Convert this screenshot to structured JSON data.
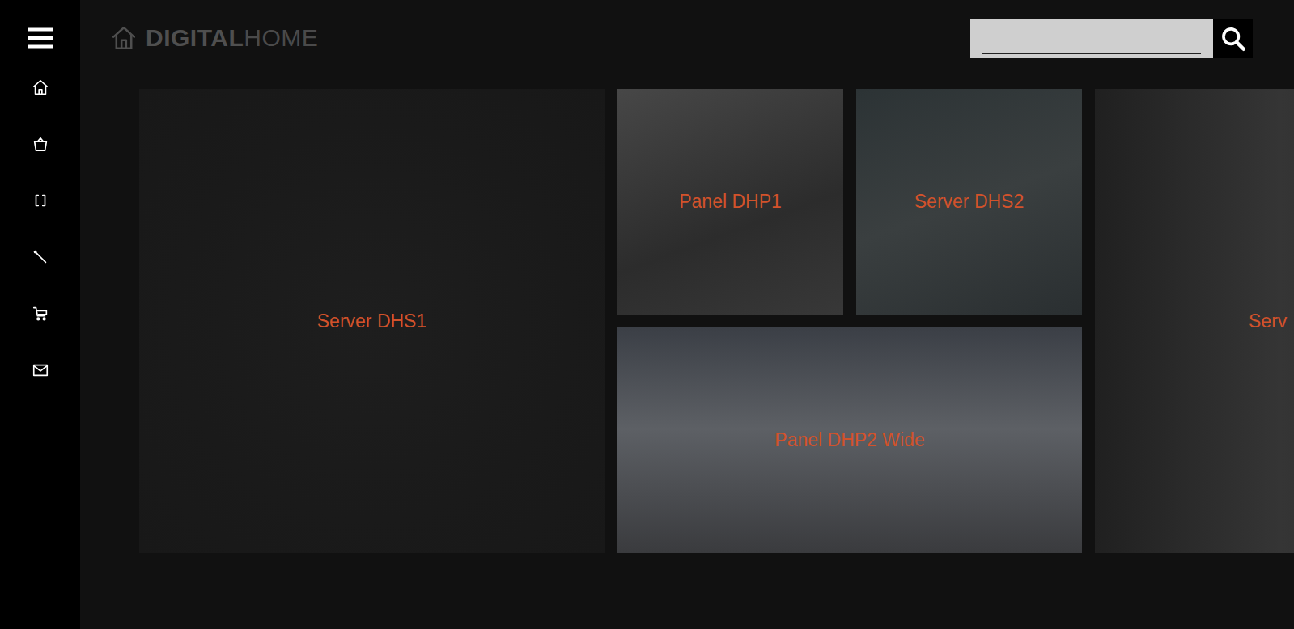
{
  "logo": {
    "bold": "DIGITAL",
    "light": "HOME"
  },
  "search": {
    "placeholder": ""
  },
  "tiles": [
    {
      "label": "Server DHS1"
    },
    {
      "label": "Panel DHP1"
    },
    {
      "label": "Server DHS2"
    },
    {
      "label": "Panel DHP2 Wide"
    },
    {
      "label": "Serv"
    }
  ]
}
